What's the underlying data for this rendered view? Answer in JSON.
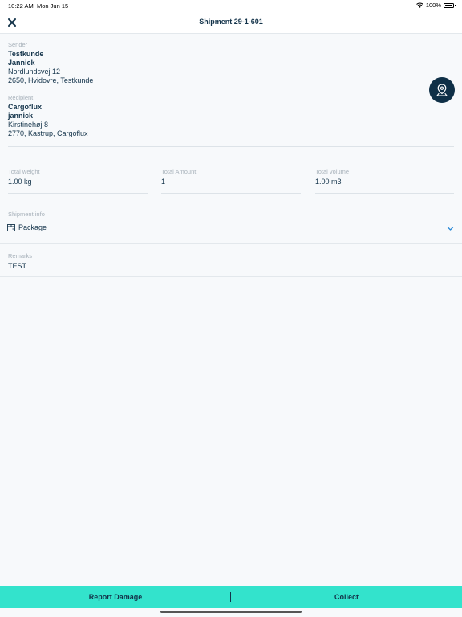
{
  "status_bar": {
    "time": "10:22 AM",
    "date": "Mon Jun 15",
    "battery": "100%",
    "battery_level": 1.0
  },
  "nav": {
    "title": "Shipment 29-1-601",
    "close_icon": "close-icon"
  },
  "sender": {
    "label": "Sender",
    "company": "Testkunde",
    "contact": "Jannick",
    "street": "Nordlundsvej 12",
    "city": "2650, Hvidovre, Testkunde"
  },
  "recipient": {
    "label": "Recipient",
    "company": "Cargoflux",
    "contact": "jannick",
    "street": "Kirstinehøj 8",
    "city": "2770, Kastrup, Cargoflux"
  },
  "map_button": {
    "icon": "map-pin-icon"
  },
  "totals": {
    "weight": {
      "label": "Total weight",
      "value": "1.00 kg"
    },
    "amount": {
      "label": "Total Amount",
      "value": "1"
    },
    "volume": {
      "label": "Total volume",
      "value": "1.00 m3"
    }
  },
  "shipment_info": {
    "label": "Shipment info",
    "type": "Package",
    "icon": "package-icon"
  },
  "remarks": {
    "label": "Remarks",
    "value": "TEST"
  },
  "actions": {
    "report_damage": "Report Damage",
    "collect": "Collect"
  },
  "colors": {
    "accent": "#33e3cc",
    "primary": "#13334a",
    "map_button": "#0f3047",
    "chevron": "#2a8ad6"
  }
}
